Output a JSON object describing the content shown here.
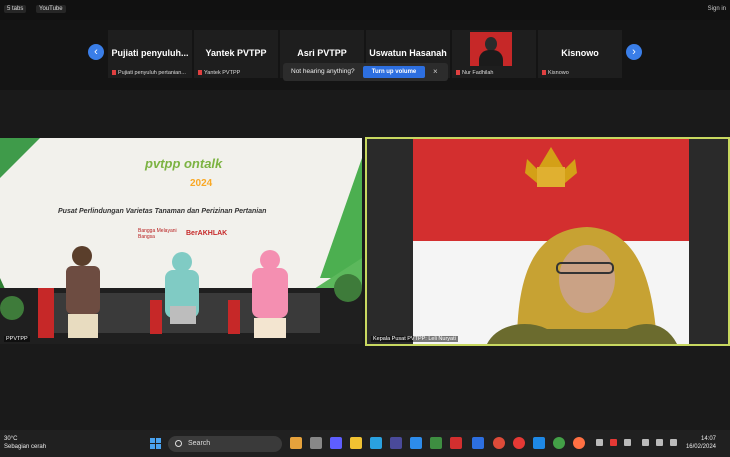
{
  "browser": {
    "tab1": "5 tabs",
    "tab2": "YouTube",
    "signin": "Sign in"
  },
  "gallery": {
    "tiles": [
      {
        "name": "Pujiati penyuluh...",
        "sub": "Pujiati penyuluh pertanian..."
      },
      {
        "name": "Yantek PVTPP",
        "sub": "Yantek PVTPP"
      },
      {
        "name": "Asri PVTPP",
        "sub": ""
      },
      {
        "name": "Uswatun Hasanah",
        "sub": ""
      },
      {
        "name": "",
        "sub": "Nur Fadhilah"
      },
      {
        "name": "Kisnowo",
        "sub": "Kisnowo"
      }
    ]
  },
  "toast": {
    "message": "Not hearing anything?",
    "button": "Turn up volume",
    "close": "×"
  },
  "videos": {
    "left_label": "PPVTPP",
    "right_label": "Kepala Pusat PVTPP: Leli Nuryati",
    "banner_title": "pvtpp ontalk",
    "banner_year": "2024",
    "banner_subtitle": "Pusat Perlindungan Varietas Tanaman dan Perizinan Pertanian",
    "banner_slogan1": "Bangga Melayani Bangsa",
    "banner_slogan2": "BerAKHLAK"
  },
  "taskbar": {
    "temp": "30°C",
    "weather": "Sebagian cerah",
    "search": "Search",
    "time": "14:07",
    "date": "16/02/2024"
  },
  "colors": {
    "accent": "#3a7ee8",
    "toast_button": "#2d6fe0",
    "active_speaker": "#c8d860"
  }
}
